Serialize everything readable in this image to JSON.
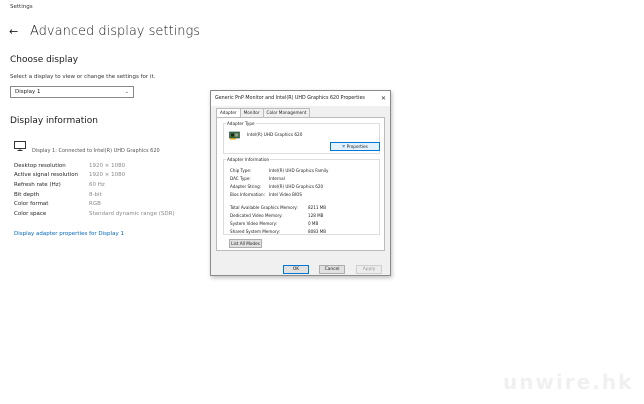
{
  "window": {
    "title": "Settings"
  },
  "page": {
    "title": "Advanced display settings"
  },
  "choose_display": {
    "heading": "Choose display",
    "subtitle": "Select a display to view or change the settings for it.",
    "selected": "Display 1"
  },
  "display_info": {
    "heading": "Display information",
    "monitor_text": "Display 1: Connected to Intel(R) UHD Graphics 620",
    "rows": [
      {
        "label": "Desktop resolution",
        "value": "1920 × 1080"
      },
      {
        "label": "Active signal resolution",
        "value": "1920 × 1080"
      },
      {
        "label": "Refresh rate (Hz)",
        "value": "60 Hz"
      },
      {
        "label": "Bit depth",
        "value": "8-bit"
      },
      {
        "label": "Color format",
        "value": "RGB"
      },
      {
        "label": "Color space",
        "value": "Standard dynamic range (SDR)"
      }
    ],
    "link": "Display adapter properties for Display 1"
  },
  "dialog": {
    "title": "Generic PnP Monitor and Intel(R) UHD Graphics 620 Properties",
    "tabs": [
      "Adapter",
      "Monitor",
      "Color Management"
    ],
    "adapter_type_label": "Adapter Type",
    "adapter_name": "Intel(R) UHD Graphics 620",
    "properties_button": "Properties",
    "adapter_info_label": "Adapter Information",
    "info": [
      {
        "key": "Chip Type:",
        "value": "Intel(R) UHD Graphics Family"
      },
      {
        "key": "DAC Type:",
        "value": "Internal"
      },
      {
        "key": "Adapter String:",
        "value": "Intel(R) UHD Graphics 620"
      },
      {
        "key": "Bios Information:",
        "value": "Intel Video BIOS"
      }
    ],
    "memory": [
      {
        "key": "Total Available Graphics Memory:",
        "value": "8211 MB"
      },
      {
        "key": "Dedicated Video Memory:",
        "value": "128 MB"
      },
      {
        "key": "System Video Memory:",
        "value": "0 MB"
      },
      {
        "key": "Shared System Memory:",
        "value": "8083 MB"
      }
    ],
    "list_modes_button": "List All Modes",
    "ok": "OK",
    "cancel": "Cancel",
    "apply": "Apply"
  },
  "watermark": "unwire.hk"
}
